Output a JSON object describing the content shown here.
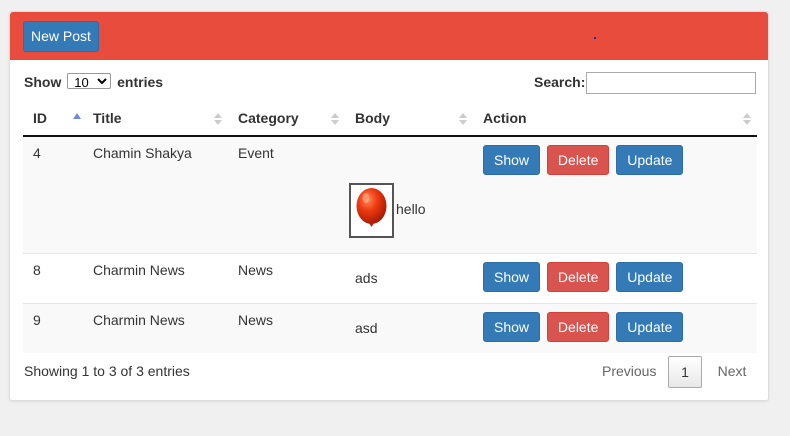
{
  "header": {
    "new_post_label": "New Post"
  },
  "length_menu": {
    "show_label": "Show",
    "entries_label": "entries",
    "selected": "10"
  },
  "search": {
    "label": "Search:",
    "value": ""
  },
  "table": {
    "columns": [
      "ID",
      "Title",
      "Category",
      "Body",
      "Action"
    ],
    "rows": [
      {
        "id": "4",
        "title": "Chamin Shakya",
        "category": "Event",
        "body": "hello",
        "image": "red-balloon"
      },
      {
        "id": "8",
        "title": "Charmin News",
        "category": "News",
        "body": "ads"
      },
      {
        "id": "9",
        "title": "Charmin News",
        "category": "News",
        "body": "asd"
      }
    ],
    "actions": {
      "show": "Show",
      "delete": "Delete",
      "update": "Update"
    }
  },
  "footer": {
    "info": "Showing 1 to 3 of 3 entries",
    "previous": "Previous",
    "current_page": "1",
    "next": "Next"
  },
  "colors": {
    "header": "#e74c3c",
    "primary": "#337ab7",
    "danger": "#d9534f"
  }
}
